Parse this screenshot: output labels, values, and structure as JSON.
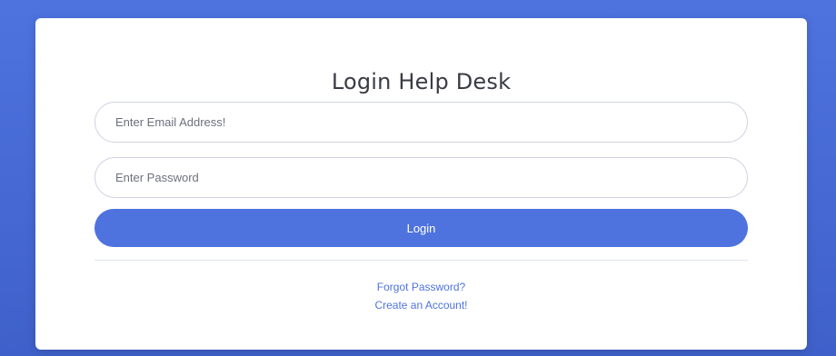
{
  "login_form": {
    "title": "Login Help Desk",
    "email_placeholder": "Enter Email Address!",
    "password_placeholder": "Enter Password",
    "login_label": "Login",
    "forgot_password_label": "Forgot Password?",
    "create_account_label": "Create an Account!"
  },
  "colors": {
    "background": "#4e73df",
    "primary": "#4e73df",
    "card": "#ffffff",
    "title_text": "#3a3b45",
    "input_border": "#d1d3e2"
  }
}
